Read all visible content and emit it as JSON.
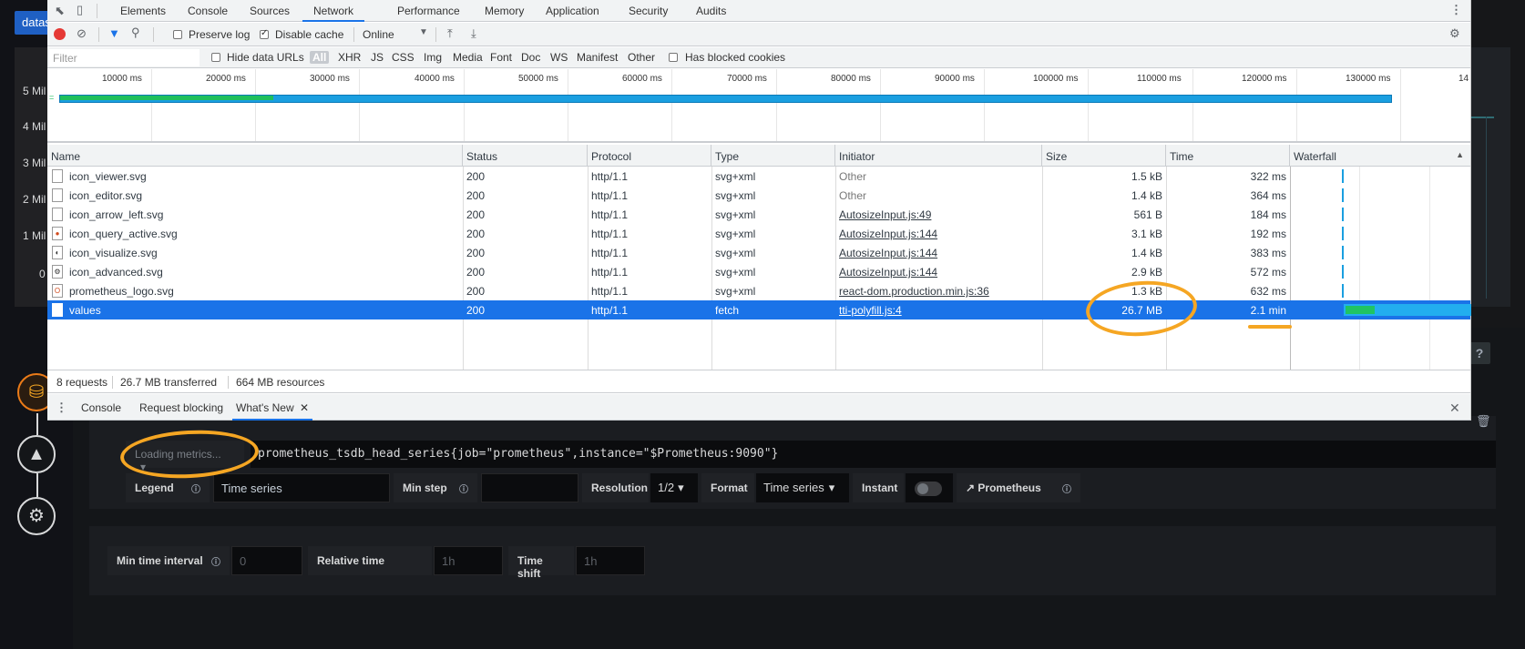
{
  "grafana": {
    "blue_button": "datas",
    "y_labels": [
      "5 Mil",
      "4 Mil",
      "3 Mil",
      "2 Mil",
      "1 Mil",
      "0"
    ],
    "loading_placeholder": "Loading metrics...",
    "query": "prometheus_tsdb_head_series{job=\"prometheus\",instance=\"$Prometheus:9090\"}",
    "legend_label": "Legend",
    "legend_value": "Time series",
    "min_step_label": "Min step",
    "min_step_value": "",
    "resolution_label": "Resolution",
    "resolution_value": "1/2",
    "format_label": "Format",
    "format_value": "Time series",
    "instant_label": "Instant",
    "datasource_label": "Prometheus",
    "min_interval_label": "Min time interval",
    "min_interval_placeholder": "0",
    "relative_time_label": "Relative time",
    "relative_time_placeholder": "1h",
    "time_shift_label": "Time shift",
    "time_shift_placeholder": "1h",
    "help": "?"
  },
  "devtools": {
    "tabs": [
      "Elements",
      "Console",
      "Sources",
      "Network",
      "Performance",
      "Memory",
      "Application",
      "Security",
      "Audits"
    ],
    "active_tab": "Network",
    "toolbar": {
      "preserve_log": "Preserve log",
      "disable_cache": "Disable cache",
      "throttle": "Online"
    },
    "filter": {
      "placeholder": "Filter",
      "hide_data_urls": "Hide data URLs",
      "types": [
        "All",
        "XHR",
        "JS",
        "CSS",
        "Img",
        "Media",
        "Font",
        "Doc",
        "WS",
        "Manifest",
        "Other"
      ],
      "has_blocked_cookies": "Has blocked cookies"
    },
    "timeline_ticks": [
      "10000 ms",
      "20000 ms",
      "30000 ms",
      "40000 ms",
      "50000 ms",
      "60000 ms",
      "70000 ms",
      "80000 ms",
      "90000 ms",
      "100000 ms",
      "110000 ms",
      "120000 ms",
      "130000 ms",
      "14"
    ],
    "columns": [
      "Name",
      "Status",
      "Protocol",
      "Type",
      "Initiator",
      "Size",
      "Time",
      "Waterfall"
    ],
    "rows": [
      {
        "name": "icon_viewer.svg",
        "status": "200",
        "protocol": "http/1.1",
        "type": "svg+xml",
        "initiator": "Other",
        "size": "1.5 kB",
        "time": "322 ms"
      },
      {
        "name": "icon_editor.svg",
        "status": "200",
        "protocol": "http/1.1",
        "type": "svg+xml",
        "initiator": "Other",
        "size": "1.4 kB",
        "time": "364 ms"
      },
      {
        "name": "icon_arrow_left.svg",
        "status": "200",
        "protocol": "http/1.1",
        "type": "svg+xml",
        "initiator": "AutosizeInput.js:49",
        "size": "561 B",
        "time": "184 ms"
      },
      {
        "name": "icon_query_active.svg",
        "status": "200",
        "protocol": "http/1.1",
        "type": "svg+xml",
        "initiator": "AutosizeInput.js:144",
        "size": "3.1 kB",
        "time": "192 ms"
      },
      {
        "name": "icon_visualize.svg",
        "status": "200",
        "protocol": "http/1.1",
        "type": "svg+xml",
        "initiator": "AutosizeInput.js:144",
        "size": "1.4 kB",
        "time": "383 ms"
      },
      {
        "name": "icon_advanced.svg",
        "status": "200",
        "protocol": "http/1.1",
        "type": "svg+xml",
        "initiator": "AutosizeInput.js:144",
        "size": "2.9 kB",
        "time": "572 ms"
      },
      {
        "name": "prometheus_logo.svg",
        "status": "200",
        "protocol": "http/1.1",
        "type": "svg+xml",
        "initiator": "react-dom.production.min.js:36",
        "size": "1.3 kB",
        "time": "632 ms"
      },
      {
        "name": "values",
        "status": "200",
        "protocol": "http/1.1",
        "type": "fetch",
        "initiator": "tti-polyfill.js:4",
        "size": "26.7 MB",
        "time": "2.1 min"
      }
    ],
    "summary": {
      "requests": "8 requests",
      "transferred": "26.7 MB transferred",
      "resources": "664 MB resources"
    },
    "drawer_tabs": [
      "Console",
      "Request blocking",
      "What's New"
    ],
    "drawer_active": "What's New"
  }
}
